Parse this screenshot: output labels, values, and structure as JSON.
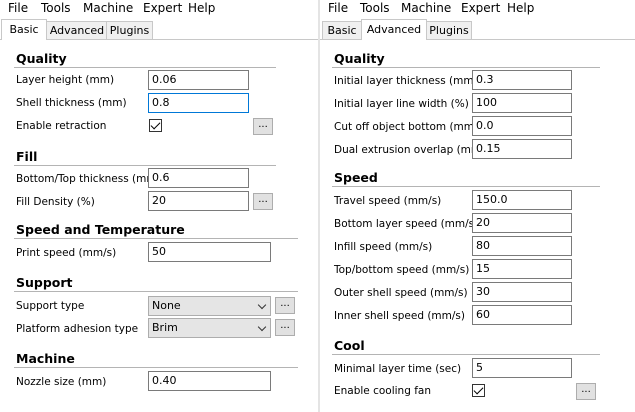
{
  "left": {
    "menu": [
      "File",
      "Tools",
      "Machine",
      "Expert",
      "Help"
    ],
    "tabs": [
      "Basic",
      "Advanced",
      "Plugins"
    ],
    "active_tab": "Basic",
    "quality": {
      "title": "Quality",
      "layer_height_label": "Layer height (mm)",
      "layer_height_value": "0.06",
      "shell_thickness_label": "Shell thickness (mm)",
      "shell_thickness_value": "0.8",
      "enable_retraction_label": "Enable retraction",
      "enable_retraction_checked": true
    },
    "fill": {
      "title": "Fill",
      "bottom_top_label": "Bottom/Top thickness (mm)",
      "bottom_top_value": "0.6",
      "fill_density_label": "Fill Density (%)",
      "fill_density_value": "20"
    },
    "speed_temp": {
      "title": "Speed and Temperature",
      "print_speed_label": "Print speed (mm/s)",
      "print_speed_value": "50"
    },
    "support": {
      "title": "Support",
      "support_type_label": "Support type",
      "support_type_value": "None",
      "platform_adhesion_label": "Platform adhesion type",
      "platform_adhesion_value": "Brim"
    },
    "machine": {
      "title": "Machine",
      "nozzle_size_label": "Nozzle size (mm)",
      "nozzle_size_value": "0.40"
    },
    "dots": "..."
  },
  "right": {
    "menu": [
      "File",
      "Tools",
      "Machine",
      "Expert",
      "Help"
    ],
    "tabs": [
      "Basic",
      "Advanced",
      "Plugins"
    ],
    "active_tab": "Advanced",
    "quality": {
      "title": "Quality",
      "fields": [
        {
          "label": "Initial layer thickness (mm)",
          "value": "0.3"
        },
        {
          "label": "Initial layer line width (%)",
          "value": "100"
        },
        {
          "label": "Cut off object bottom (mm)",
          "value": "0.0"
        },
        {
          "label": "Dual extrusion overlap (mm)",
          "value": "0.15"
        }
      ]
    },
    "speed": {
      "title": "Speed",
      "fields": [
        {
          "label": "Travel speed (mm/s)",
          "value": "150.0"
        },
        {
          "label": "Bottom layer speed (mm/s)",
          "value": "20"
        },
        {
          "label": "Infill speed (mm/s)",
          "value": "80"
        },
        {
          "label": "Top/bottom speed (mm/s)",
          "value": "15"
        },
        {
          "label": "Outer shell speed (mm/s)",
          "value": "30"
        },
        {
          "label": "Inner shell speed (mm/s)",
          "value": "60"
        }
      ]
    },
    "cool": {
      "title": "Cool",
      "min_layer_time_label": "Minimal layer time (sec)",
      "min_layer_time_value": "5",
      "cooling_fan_label": "Enable cooling fan",
      "cooling_fan_checked": true
    },
    "dots": "..."
  }
}
